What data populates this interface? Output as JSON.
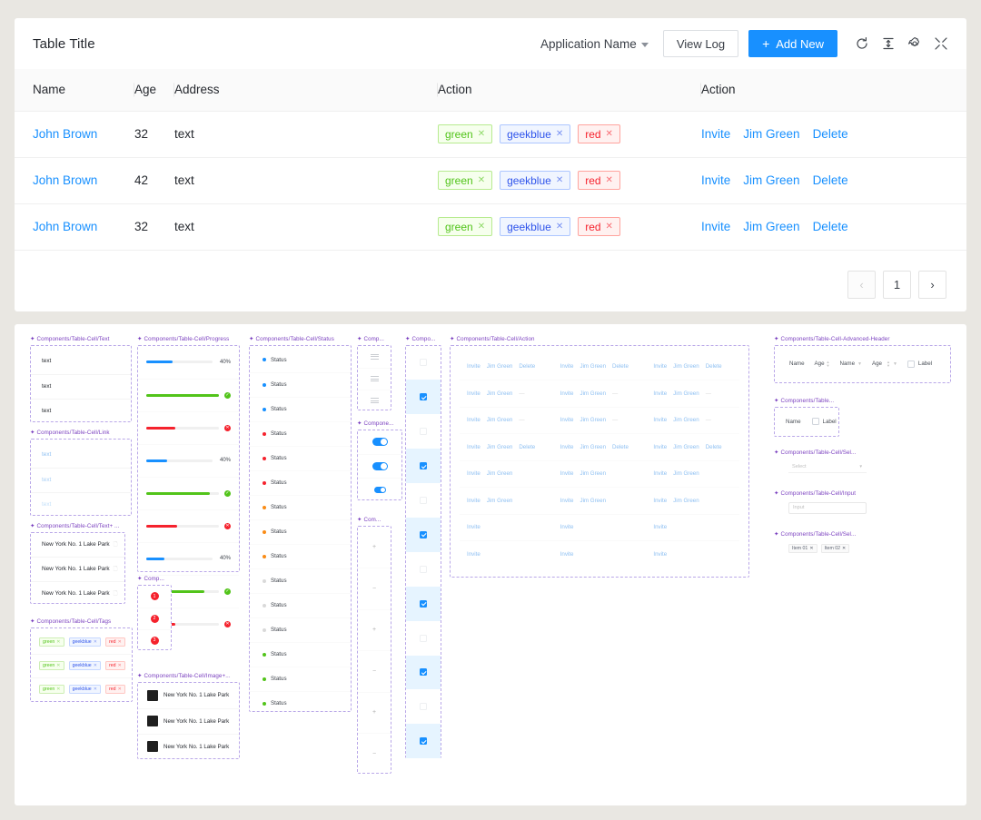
{
  "header": {
    "title": "Table Title",
    "app_name": "Application Name",
    "view_log": "View Log",
    "add_new": "Add New",
    "plus": "+",
    "icons": [
      "reload-icon",
      "column-height-icon",
      "gear-icon",
      "compress-icon"
    ]
  },
  "table": {
    "columns": [
      "Name",
      "Age",
      "Address",
      "Action",
      "Action"
    ],
    "rows": [
      {
        "name": "John Brown",
        "age": "32",
        "address": "text",
        "tags": [
          {
            "label": "green",
            "close": "✕",
            "kind": "green"
          },
          {
            "label": "geekblue",
            "close": "✕",
            "kind": "geek"
          },
          {
            "label": "red",
            "close": "✕",
            "kind": "red"
          }
        ],
        "actions": [
          "Invite",
          "Jim Green",
          "Delete"
        ]
      },
      {
        "name": "John Brown",
        "age": "42",
        "address": "text",
        "tags": [
          {
            "label": "green",
            "close": "✕",
            "kind": "green"
          },
          {
            "label": "geekblue",
            "close": "✕",
            "kind": "geek"
          },
          {
            "label": "red",
            "close": "✕",
            "kind": "red"
          }
        ],
        "actions": [
          "Invite",
          "Jim Green",
          "Delete"
        ]
      },
      {
        "name": "John Brown",
        "age": "32",
        "address": "text",
        "tags": [
          {
            "label": "green",
            "close": "✕",
            "kind": "green"
          },
          {
            "label": "geekblue",
            "close": "✕",
            "kind": "geek"
          },
          {
            "label": "red",
            "close": "✕",
            "kind": "red"
          }
        ],
        "actions": [
          "Invite",
          "Jim Green",
          "Delete"
        ]
      }
    ]
  },
  "pagination": {
    "prev": "‹",
    "page": "1",
    "next": "›"
  },
  "canvas": {
    "frames": {
      "text": {
        "label": "Components/Table-Cell/Text",
        "cells": [
          "text",
          "text",
          "text"
        ]
      },
      "link": {
        "label": "Components/Table-Cell/Link",
        "cells": [
          "text",
          "text",
          "text"
        ]
      },
      "text_plus": {
        "label": "Components/Table-Cell/Text+ ...",
        "cells": [
          "New York No. 1 Lake Park",
          "New York No. 1 Lake Park",
          "New York No. 1 Lake Park"
        ]
      },
      "tags": {
        "label": "Components/Table-Cell/Tags",
        "rows": [
          [
            {
              "label": "green",
              "kind": "green"
            },
            {
              "label": "geekblue",
              "kind": "geek"
            },
            {
              "label": "red",
              "kind": "red"
            }
          ],
          [
            {
              "label": "green",
              "kind": "green"
            },
            {
              "label": "geekblue",
              "kind": "geek"
            },
            {
              "label": "red",
              "kind": "red"
            }
          ],
          [
            {
              "label": "green",
              "kind": "green"
            },
            {
              "label": "geekblue",
              "kind": "geek"
            },
            {
              "label": "red",
              "kind": "red"
            }
          ]
        ]
      },
      "progress": {
        "label": "Components/Table-Cell/Progress",
        "rows": [
          {
            "pct": "40%",
            "value": 40,
            "color": "#1890ff",
            "mode": "pct"
          },
          {
            "pct": "100%",
            "value": 100,
            "color": "#52c41a",
            "mode": "ok",
            "glyph": "✓"
          },
          {
            "pct": "40%",
            "value": 40,
            "color": "#f5222d",
            "mode": "err",
            "glyph": "✕"
          },
          {
            "pct": "40%",
            "value": 32,
            "color": "#1890ff",
            "mode": "pct"
          },
          {
            "pct": "88%",
            "value": 88,
            "color": "#52c41a",
            "mode": "ok",
            "glyph": "✓"
          },
          {
            "pct": "43%",
            "value": 43,
            "color": "#f5222d",
            "mode": "err",
            "glyph": "✕"
          },
          {
            "pct": "40%",
            "value": 28,
            "color": "#1890ff",
            "mode": "pct"
          },
          {
            "pct": "80%",
            "value": 80,
            "color": "#52c41a",
            "mode": "ok",
            "glyph": "✓"
          },
          {
            "pct": "40%",
            "value": 40,
            "color": "#f5222d",
            "mode": "err",
            "glyph": "✕"
          }
        ]
      },
      "badge": {
        "label": "Comp...",
        "values": [
          "1",
          "2",
          "3"
        ]
      },
      "image_plus": {
        "label": "Components/Table-Cell/Image+...",
        "cells": [
          "New York No. 1 Lake Park",
          "New York No. 1 Lake Park",
          "New York No. 1 Lake Park"
        ]
      },
      "status": {
        "label": "Components/Table-Cell/Status",
        "rows": [
          {
            "text": "Status",
            "color": "#1890ff"
          },
          {
            "text": "Status",
            "color": "#1890ff"
          },
          {
            "text": "Status",
            "color": "#1890ff"
          },
          {
            "text": "Status",
            "color": "#f5222d"
          },
          {
            "text": "Status",
            "color": "#f5222d"
          },
          {
            "text": "Status",
            "color": "#f5222d"
          },
          {
            "text": "Status",
            "color": "#fa8c16"
          },
          {
            "text": "Status",
            "color": "#fa8c16"
          },
          {
            "text": "Status",
            "color": "#fa8c16"
          },
          {
            "text": "Status",
            "color": "#d9d9d9"
          },
          {
            "text": "Status",
            "color": "#d9d9d9"
          },
          {
            "text": "Status",
            "color": "#d9d9d9"
          },
          {
            "text": "Status",
            "color": "#52c41a"
          },
          {
            "text": "Status",
            "color": "#52c41a"
          },
          {
            "text": "Status",
            "color": "#52c41a"
          }
        ]
      },
      "drag": {
        "label": "Comp...",
        "count": 3
      },
      "switch": {
        "label": "Compone...",
        "count": 3
      },
      "expand": {
        "label": "Com...",
        "glyphs": [
          "+",
          "−",
          "+",
          "−",
          "+",
          "−"
        ]
      },
      "checkbox": {
        "label": "Compo...",
        "rows": [
          {
            "checked": false,
            "sel": false
          },
          {
            "checked": true,
            "sel": true
          },
          {
            "checked": false,
            "sel": false
          },
          {
            "checked": true,
            "sel": true
          },
          {
            "checked": false,
            "sel": false
          },
          {
            "checked": true,
            "sel": true
          },
          {
            "checked": false,
            "sel": false
          },
          {
            "checked": true,
            "sel": true
          },
          {
            "checked": false,
            "sel": false
          },
          {
            "checked": true,
            "sel": true
          },
          {
            "checked": false,
            "sel": false
          },
          {
            "checked": true,
            "sel": true
          }
        ]
      },
      "action": {
        "label": "Components/Table-Cell/Action",
        "rows": [
          [
            "Invite",
            "Jim Green",
            "Delete"
          ],
          [
            "Invite",
            "Jim Green",
            "—"
          ],
          [
            "Invite",
            "Jim Green",
            "—"
          ],
          [
            "Invite",
            "Jim Green",
            "Delete"
          ],
          [
            "Invite",
            "Jim Green",
            ""
          ],
          [
            "Invite",
            "Jim Green",
            ""
          ],
          [
            "Invite",
            "",
            ""
          ],
          [
            "Invite",
            "",
            ""
          ]
        ],
        "col_count": 3
      },
      "adv_header": {
        "label": "Components/Table-Cell-Advanced-Header",
        "items": [
          "Name",
          "Age",
          "Name",
          "Age",
          "Label"
        ],
        "checkbox_label": "Label"
      },
      "simple_header": {
        "label": "Components/Table...",
        "items": [
          "Name",
          "Label"
        ]
      },
      "select": {
        "label": "Components/Table-Cell/Sel...",
        "placeholder": "Select"
      },
      "input": {
        "label": "Components/Table-Cell/Input",
        "placeholder": "Input"
      },
      "select_tags": {
        "label": "Components/Table-Cell/Sel...",
        "tags": [
          "Item 01",
          "Item 02"
        ]
      }
    }
  },
  "colors": {
    "accent": "#1890ff",
    "green": "#52c41a",
    "red": "#f5222d",
    "geekblue": "#2f54eb",
    "orange": "#fa8c16",
    "frame_label": "#7a3fbf",
    "page_bg": "#e9e7e2"
  }
}
